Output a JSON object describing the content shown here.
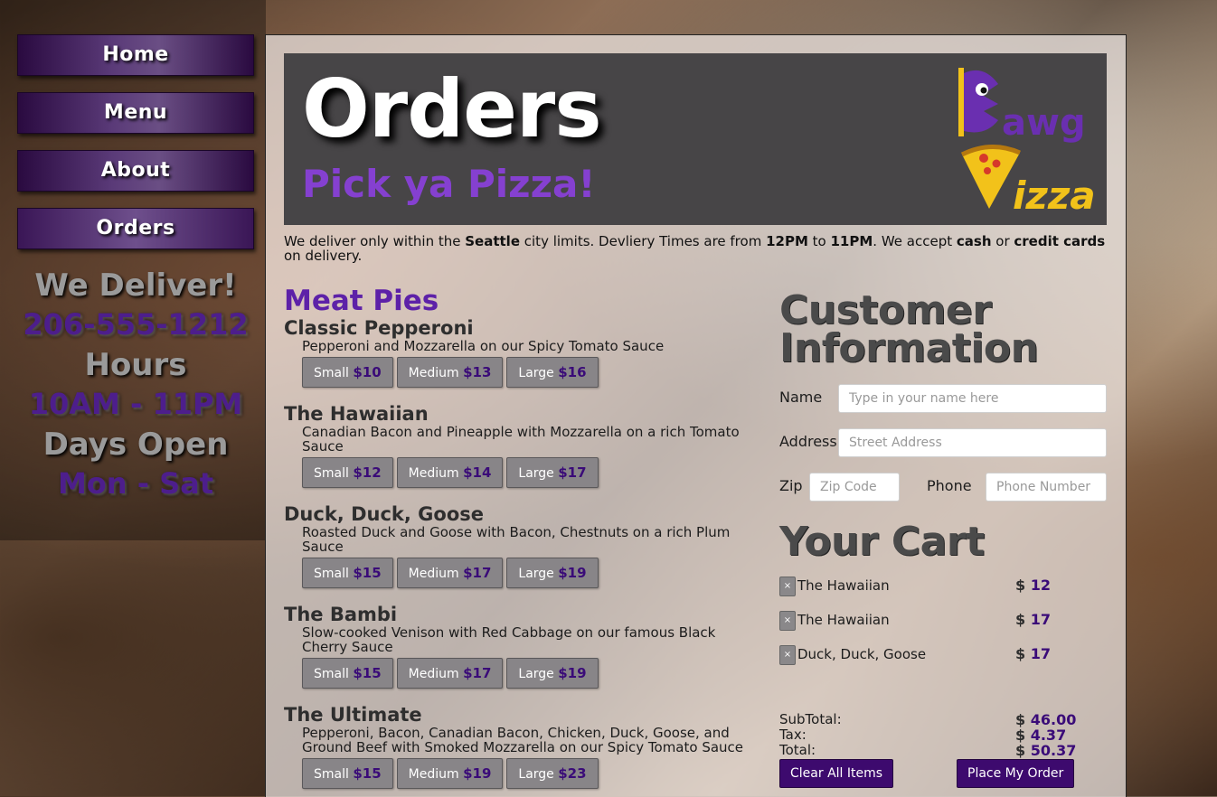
{
  "nav": {
    "items": [
      "Home",
      "Menu",
      "About",
      "Orders"
    ],
    "active": "Orders"
  },
  "promo": {
    "deliver": "We Deliver!",
    "phone": "206-555-1212",
    "hours_label": "Hours",
    "hours": "10AM - 11PM",
    "days_label": "Days Open",
    "days": "Mon - Sat"
  },
  "banner": {
    "title": "Orders",
    "subtitle": "Pick ya Pizza!",
    "logo_text_top": "awg",
    "logo_text_bottom": "izza"
  },
  "intro": {
    "p1": "We deliver only within the ",
    "city": "Seattle",
    "p2": " city limits. Devliery Times are from ",
    "start": "12PM",
    "p3": " to ",
    "end": "11PM",
    "p4": ". We accept ",
    "cash": "cash",
    "p5": " or ",
    "cards": "credit cards",
    "p6": " on delivery."
  },
  "menu": {
    "section_title": "Meat Pies",
    "pies": [
      {
        "name": "Classic Pepperoni",
        "desc": "Pepperoni and Mozzarella on our Spicy Tomato Sauce",
        "sizes": [
          {
            "label": "Small",
            "price": "$10"
          },
          {
            "label": "Medium",
            "price": "$13"
          },
          {
            "label": "Large",
            "price": "$16"
          }
        ]
      },
      {
        "name": "The Hawaiian",
        "desc": "Canadian Bacon and Pineapple with Mozzarella on a rich Tomato Sauce",
        "sizes": [
          {
            "label": "Small",
            "price": "$12"
          },
          {
            "label": "Medium",
            "price": "$14"
          },
          {
            "label": "Large",
            "price": "$17"
          }
        ]
      },
      {
        "name": "Duck, Duck, Goose",
        "desc": "Roasted Duck and Goose with Bacon, Chestnuts on a rich Plum Sauce",
        "sizes": [
          {
            "label": "Small",
            "price": "$15"
          },
          {
            "label": "Medium",
            "price": "$17"
          },
          {
            "label": "Large",
            "price": "$19"
          }
        ]
      },
      {
        "name": "The Bambi",
        "desc": "Slow-cooked Venison with Red Cabbage on our famous Black Cherry Sauce",
        "sizes": [
          {
            "label": "Small",
            "price": "$15"
          },
          {
            "label": "Medium",
            "price": "$17"
          },
          {
            "label": "Large",
            "price": "$19"
          }
        ]
      },
      {
        "name": "The Ultimate",
        "desc": "Pepperoni, Bacon, Canadian Bacon, Chicken, Duck, Goose, and Ground Beef with Smoked Mozzarella on our Spicy Tomato Sauce",
        "sizes": [
          {
            "label": "Small",
            "price": "$15"
          },
          {
            "label": "Medium",
            "price": "$19"
          },
          {
            "label": "Large",
            "price": "$23"
          }
        ]
      }
    ]
  },
  "customer": {
    "title_line1": "Customer",
    "title_line2": "Information",
    "name_label": "Name",
    "name_placeholder": "Type in your name here",
    "address_label": "Address",
    "address_placeholder": "Street Address",
    "zip_label": "Zip",
    "zip_placeholder": "Zip Code",
    "phone_label": "Phone",
    "phone_placeholder": "Phone Number"
  },
  "cart": {
    "title": "Your Cart",
    "remove_glyph": "×",
    "currency": "$",
    "items": [
      {
        "name": "The Hawaiian",
        "price": "12"
      },
      {
        "name": "The Hawaiian",
        "price": "17"
      },
      {
        "name": "Duck, Duck, Goose",
        "price": "17"
      }
    ],
    "subtotal_label": "SubTotal:",
    "subtotal": "46.00",
    "tax_label": "Tax:",
    "tax": "4.37",
    "total_label": "Total:",
    "total": "50.37",
    "clear_label": "Clear All Items",
    "place_label": "Place My Order"
  },
  "colors": {
    "accent": "#3d0a6e",
    "title_purple": "#5d21a8",
    "banner_bg": "#474547",
    "logo_yellow": "#f2c21a",
    "logo_purple": "#6a2fb0"
  }
}
